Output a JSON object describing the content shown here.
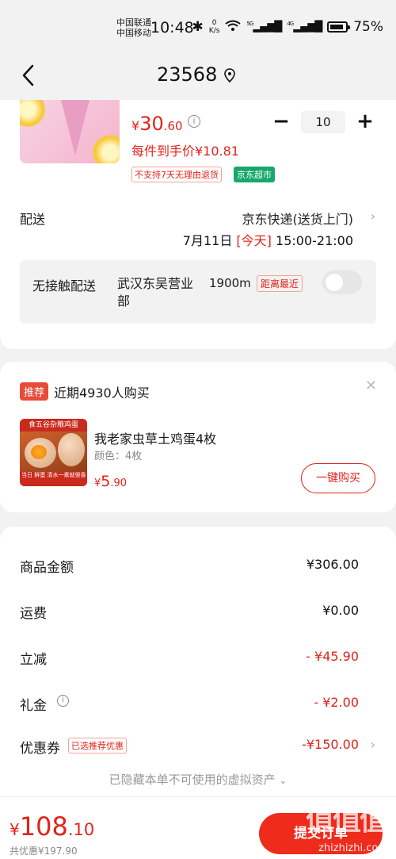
{
  "status_bar": {
    "carrier1": "中国联通",
    "carrier2": "中国移动",
    "time": "10:48",
    "speed_value": "0",
    "speed_unit": "K/s",
    "net1": "5G",
    "net2": "4G",
    "battery": "75%"
  },
  "nav": {
    "title": "23568"
  },
  "product": {
    "price_symbol": "¥",
    "price_int": "30",
    "price_dec": ".60",
    "quantity": "10",
    "per_item_price": "每件到手价¥10.81",
    "no_return_tag": "不支持7天无理由退货",
    "store_tag": "京东超市"
  },
  "shipping": {
    "label": "配送",
    "method": "京东快递(送货上门)",
    "date": "7月11日 ",
    "today": "[今天]",
    "time_range": " 15:00-21:00"
  },
  "contactless": {
    "label": "无接触配送",
    "place": "武汉东吴营业部",
    "distance": "1900m",
    "nearest": "距离最近"
  },
  "recommend": {
    "badge": "推荐",
    "title": "近期4930人购买",
    "img_top": "食五谷杂粮鸡蛋",
    "img_bottom": "当日 鲜蛋 清水一煮就很香",
    "name": "我老家虫草土鸡蛋4枚",
    "spec": "颜色：4枚",
    "price_symbol": "¥",
    "price_int": "5",
    "price_dec": ".90",
    "buy_label": "一键购买"
  },
  "summary": {
    "rows": [
      {
        "label": "商品金额",
        "value": "¥306.00"
      },
      {
        "label": "运费",
        "value": "¥0.00"
      },
      {
        "label": "立减",
        "value": "- ¥45.90"
      },
      {
        "label": "礼金",
        "value": "- ¥2.00"
      },
      {
        "label": "优惠券",
        "value": "-¥150.00"
      }
    ],
    "coupon_tag": "已选推荐优惠",
    "hidden_assets": "已隐藏本单不可使用的虚拟资产"
  },
  "bottom": {
    "total_symbol": "¥",
    "total_int": "108",
    "total_dec": ".10",
    "saving": "共优惠¥197.90",
    "submit_label": "提交订单",
    "watermark_logo": "值值值",
    "watermark_url": "zhizhizhi.com"
  },
  "colors": {
    "accent_red": "#e2231a",
    "store_green": "#17a86a",
    "page_bg": "#f2f2f2"
  }
}
